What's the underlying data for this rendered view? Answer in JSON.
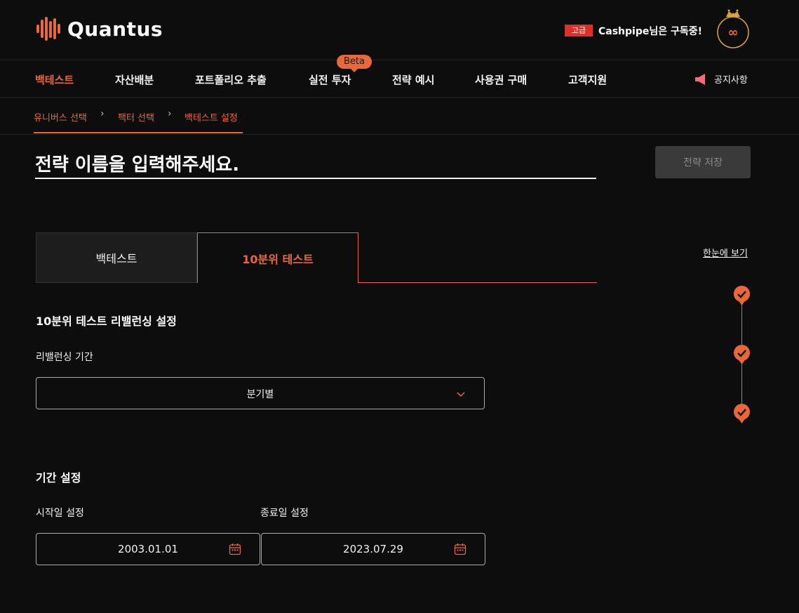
{
  "brand": {
    "name": "Quantus"
  },
  "subscription": {
    "badge": "고급",
    "text": "Cashpipe님은 구독중!"
  },
  "nav": {
    "items": [
      "백테스트",
      "자산배분",
      "포트폴리오 추출",
      "실전 투자",
      "전략 예시",
      "사용권 구매",
      "고객지원"
    ],
    "beta_label": "Beta",
    "notice_label": "공지사항"
  },
  "breadcrumb": [
    "유니버스 선택",
    "팩터 선택",
    "백테스트 설정"
  ],
  "strategy": {
    "title_placeholder": "전략 이름을 입력해주세요.",
    "save_label": "전략 저장"
  },
  "tabs": [
    "백테스트",
    "10분위 테스트"
  ],
  "overview_link": "한눈에 보기",
  "rebalancing": {
    "section_title": "10분위 테스트 리밸런싱 설정",
    "label": "리밸런싱 기간",
    "selected": "분기별"
  },
  "period": {
    "section_title": "기간 설정",
    "start_label": "시작일 설정",
    "start_value": "2003.01.01",
    "end_label": "종료일 설정",
    "end_value": "2023.07.29"
  },
  "colors": {
    "accent": "#e8683a",
    "badge_red": "#e0302a",
    "background": "#0d0d0d"
  }
}
